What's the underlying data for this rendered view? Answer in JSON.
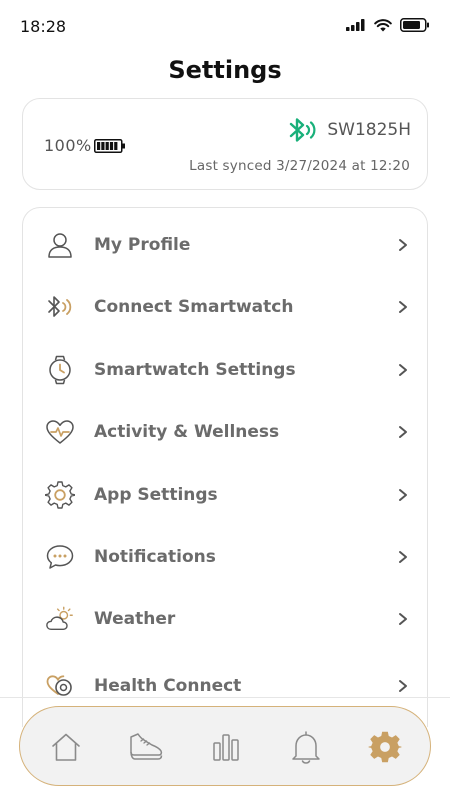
{
  "status_bar": {
    "time": "18:28",
    "icons": [
      "signal-icon",
      "wifi-icon",
      "battery-icon"
    ]
  },
  "page": {
    "title": "Settings"
  },
  "device": {
    "battery_percent": "100%",
    "battery_level": 1.0,
    "name": "SW1825H",
    "last_synced": "Last synced  3/27/2024 at 12:20",
    "bluetooth_color": "#19b07a"
  },
  "menu": {
    "items": [
      {
        "label": "My Profile",
        "icon": "user-icon"
      },
      {
        "label": "Connect Smartwatch",
        "icon": "bluetooth-icon"
      },
      {
        "label": "Smartwatch Settings",
        "icon": "watch-icon"
      },
      {
        "label": "Activity & Wellness",
        "icon": "heart-pulse-icon"
      },
      {
        "label": "App Settings",
        "icon": "gear-icon"
      },
      {
        "label": "Notifications",
        "icon": "chat-bubble-icon"
      },
      {
        "label": "Weather",
        "icon": "weather-icon"
      },
      {
        "label": "Health Connect",
        "icon": "health-connect-icon"
      }
    ]
  },
  "tab_bar": {
    "tabs": [
      {
        "icon": "home-icon",
        "active": false
      },
      {
        "icon": "shoe-icon",
        "active": false
      },
      {
        "icon": "bar-chart-icon",
        "active": false
      },
      {
        "icon": "bell-icon",
        "active": false
      },
      {
        "icon": "gear-icon",
        "active": true
      }
    ],
    "accent_color": "#c9a063"
  }
}
